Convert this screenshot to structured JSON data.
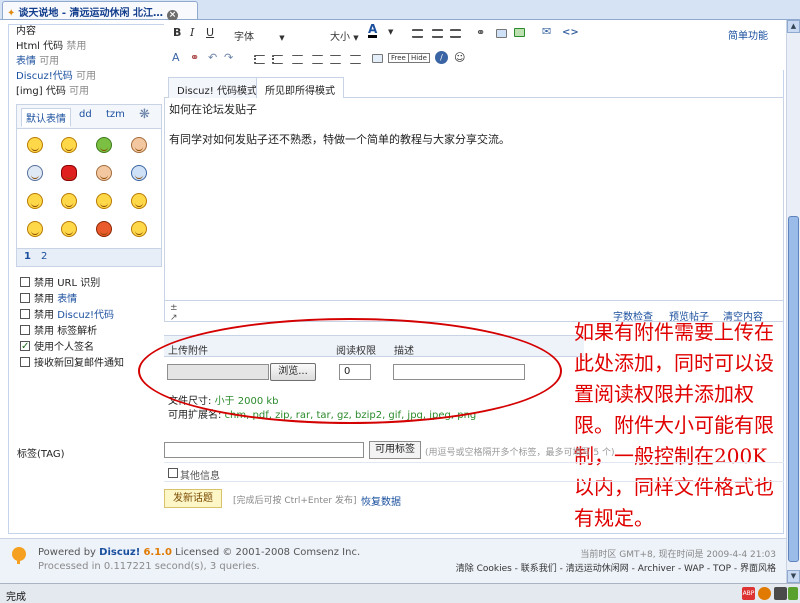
{
  "browser": {
    "tab_title": "谈天说地 - 清远运动休闲 北江…",
    "status_text": "完成"
  },
  "left": {
    "content_title": "内容",
    "html_code": "Html 代码",
    "html_state": "禁用",
    "smilies": "表情",
    "smilies_state": "可用",
    "discuz_code": "Discuz!代码",
    "discuz_state": "可用",
    "img_code": "[img] 代码",
    "img_state": "可用",
    "smiley_tabs": [
      "默认表情",
      "dd",
      "tzm"
    ],
    "smiley_pages": [
      "1",
      "2"
    ],
    "options": [
      {
        "prefix": "禁用",
        "label": "URL 识别",
        "checked": false
      },
      {
        "prefix": "禁用",
        "label": "表情",
        "checked": false
      },
      {
        "prefix": "禁用",
        "label": "Discuz!代码",
        "checked": false
      },
      {
        "prefix": "禁用",
        "label": "标签解析",
        "checked": false
      },
      {
        "prefix": "",
        "label": "使用个人签名",
        "checked": true
      },
      {
        "prefix": "",
        "label": "接收新回复邮件通知",
        "checked": false
      }
    ]
  },
  "toolbar": {
    "font_label": "字体",
    "size_label": "大小",
    "simple_mode": "简单功能"
  },
  "editor": {
    "tabs": [
      "Discuz! 代码模式",
      "所见即所得模式"
    ],
    "lines": [
      "如何在论坛发贴子",
      "有同学对如何发贴子还不熟悉，特做一个简单的教程与大家分享交流。"
    ],
    "footer_links": [
      "字数检查",
      "预览帖子",
      "清空内容"
    ]
  },
  "attachment": {
    "col_file": "上传附件",
    "col_perm": "阅读权限",
    "col_desc": "描述",
    "browse_label": "浏览...",
    "perm_value": "0",
    "size_label": "文件尺寸:",
    "size_value": "小于 2000 kb",
    "ext_label": "可用扩展名:",
    "ext_value": "chm, pdf, zip, rar, tar, gz, bzip2, gif, jpg, jpeg, png"
  },
  "annotation": {
    "text": "如果有附件需要上传在此处添加，同时可以设置阅读权限并添加权限。附件大小可能有限制，一般控制在200K以内，同样文件格式也有规定。",
    "color": "#e00000"
  },
  "tags": {
    "label": "标签(TAG)",
    "button": "可用标签",
    "hint": "(用逗号或空格隔开多个标签，最多可填写 5 个)"
  },
  "other_info": "其他信息",
  "submit": {
    "button": "发新话题",
    "hint": "[完成后可按 Ctrl+Enter 发布]",
    "restore": "恢复数据"
  },
  "footer": {
    "powered_prefix": "Powered by",
    "product": "Discuz!",
    "version": "6.1.0",
    "license": "Licensed © 2001-2008 Comsenz Inc.",
    "processed": "Processed in 0.117221 second(s), 3 queries.",
    "time_info": "当前时区 GMT+8, 现在时间是 2009-4-4 21:03",
    "links": "清除 Cookies - 联系我们 - 清远运动休闲网 - Archiver - WAP - TOP - 界面风格"
  },
  "colors": {
    "accent": "#1a4f9e",
    "green": "#2b8a2b",
    "annotation": "#e00000"
  }
}
